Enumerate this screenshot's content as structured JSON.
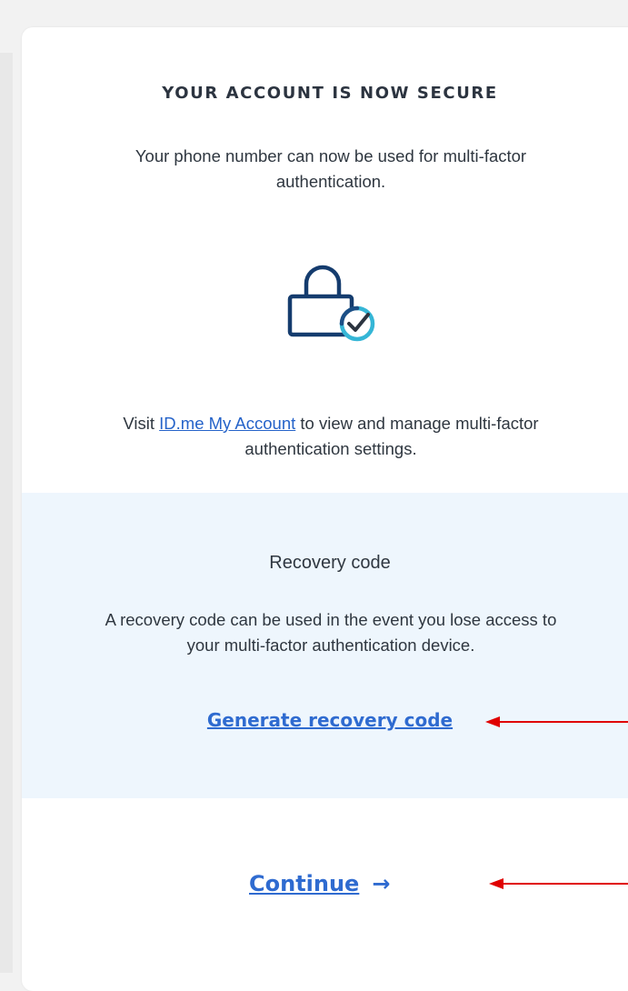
{
  "success": {
    "heading": "YOUR ACCOUNT IS NOW SECURE",
    "message": "Your phone number can now be used for multi-factor authentication.",
    "icon": "lock-check-icon"
  },
  "manage": {
    "prefix": "Visit ",
    "link_text": "ID.me My Account",
    "suffix": " to view and manage multi-factor authentication settings."
  },
  "recovery": {
    "title": "Recovery code",
    "description": "A recovery code can be used in the event you lose access to your multi-factor authentication device.",
    "link_text": "Generate recovery code"
  },
  "actions": {
    "continue_label": "Continue",
    "continue_arrow": "→"
  },
  "colors": {
    "link": "#2f6bd0",
    "panel_bg": "#eef6fd",
    "annotation_arrow": "#e00000",
    "lock_navy": "#153c6e",
    "check_teal": "#35b6d6"
  }
}
